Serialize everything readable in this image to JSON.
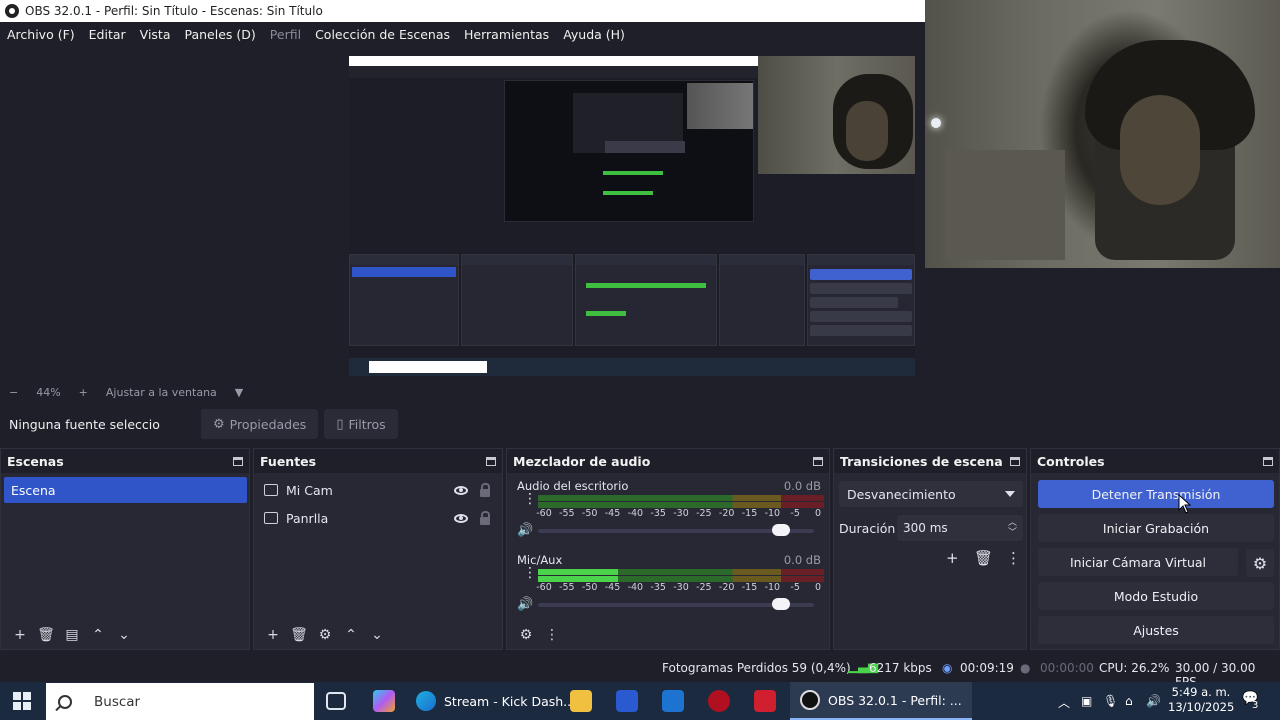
{
  "window": {
    "title": "OBS 32.0.1 - Perfil: Sin Título - Escenas: Sin Título"
  },
  "menu": [
    {
      "label": "Archivo (F)",
      "enabled": true
    },
    {
      "label": "Editar",
      "enabled": true
    },
    {
      "label": "Vista",
      "enabled": true
    },
    {
      "label": "Paneles (D)",
      "enabled": true
    },
    {
      "label": "Perfil",
      "enabled": false
    },
    {
      "label": "Colección de Escenas",
      "enabled": true
    },
    {
      "label": "Herramientas",
      "enabled": true
    },
    {
      "label": "Ayuda (H)",
      "enabled": true
    }
  ],
  "zoombar": {
    "minus": "−",
    "zoom": "44%",
    "plus": "+",
    "fit": "Ajustar a la ventana",
    "arrow": "▼"
  },
  "source_toolbar": {
    "none_selected": "Ninguna fuente seleccionada",
    "properties": "Propiedades",
    "filters": "Filtros"
  },
  "scenes": {
    "title": "Escenas",
    "items": [
      "Escena"
    ]
  },
  "sources": {
    "title": "Fuentes",
    "items": [
      {
        "label": "Mi Cam",
        "icon": "camera-icon"
      },
      {
        "label": "Panrlla",
        "icon": "monitor-icon"
      }
    ]
  },
  "mixer": {
    "title": "Mezclador de audio",
    "channels": [
      {
        "name": "Audio del escritorio",
        "db": "0.0 dB",
        "level": 0.0
      },
      {
        "name": "Mic/Aux",
        "db": "0.0 dB",
        "level": 0.28
      }
    ],
    "scale": [
      "-60",
      "-55",
      "-50",
      "-45",
      "-40",
      "-35",
      "-30",
      "-25",
      "-20",
      "-15",
      "-10",
      "-5",
      "0"
    ]
  },
  "transitions": {
    "title": "Transiciones de escena",
    "selected": "Desvanecimiento",
    "duration_label": "Duración",
    "duration_value": "300 ms"
  },
  "controls": {
    "title": "Controles",
    "stop_stream": "Detener Transmisión",
    "start_record": "Iniciar Grabación",
    "start_virtual_cam": "Iniciar Cámara Virtual",
    "studio_mode": "Modo Estudio",
    "settings": "Ajustes"
  },
  "status": {
    "dropped_frames": "Fotogramas Perdidos 59 (0,4%)",
    "bitrate": "6217 kbps",
    "stream_time": "00:09:19",
    "record_time": "00:00:00",
    "cpu": "CPU: 26.2%",
    "fps": "30.00 / 30.00 FPS"
  },
  "taskbar": {
    "search": "Buscar",
    "tasks": [
      "Stream - Kick Dash...",
      "OBS 32.0.1 - Perfil: ..."
    ],
    "time": "5:49 a. m.",
    "date": "13/10/2025",
    "notifications": "3"
  },
  "colors": {
    "accent": "#3f62d0",
    "panel": "#272833",
    "bg": "#1e1f28",
    "meter_green": "#4cd34c"
  }
}
